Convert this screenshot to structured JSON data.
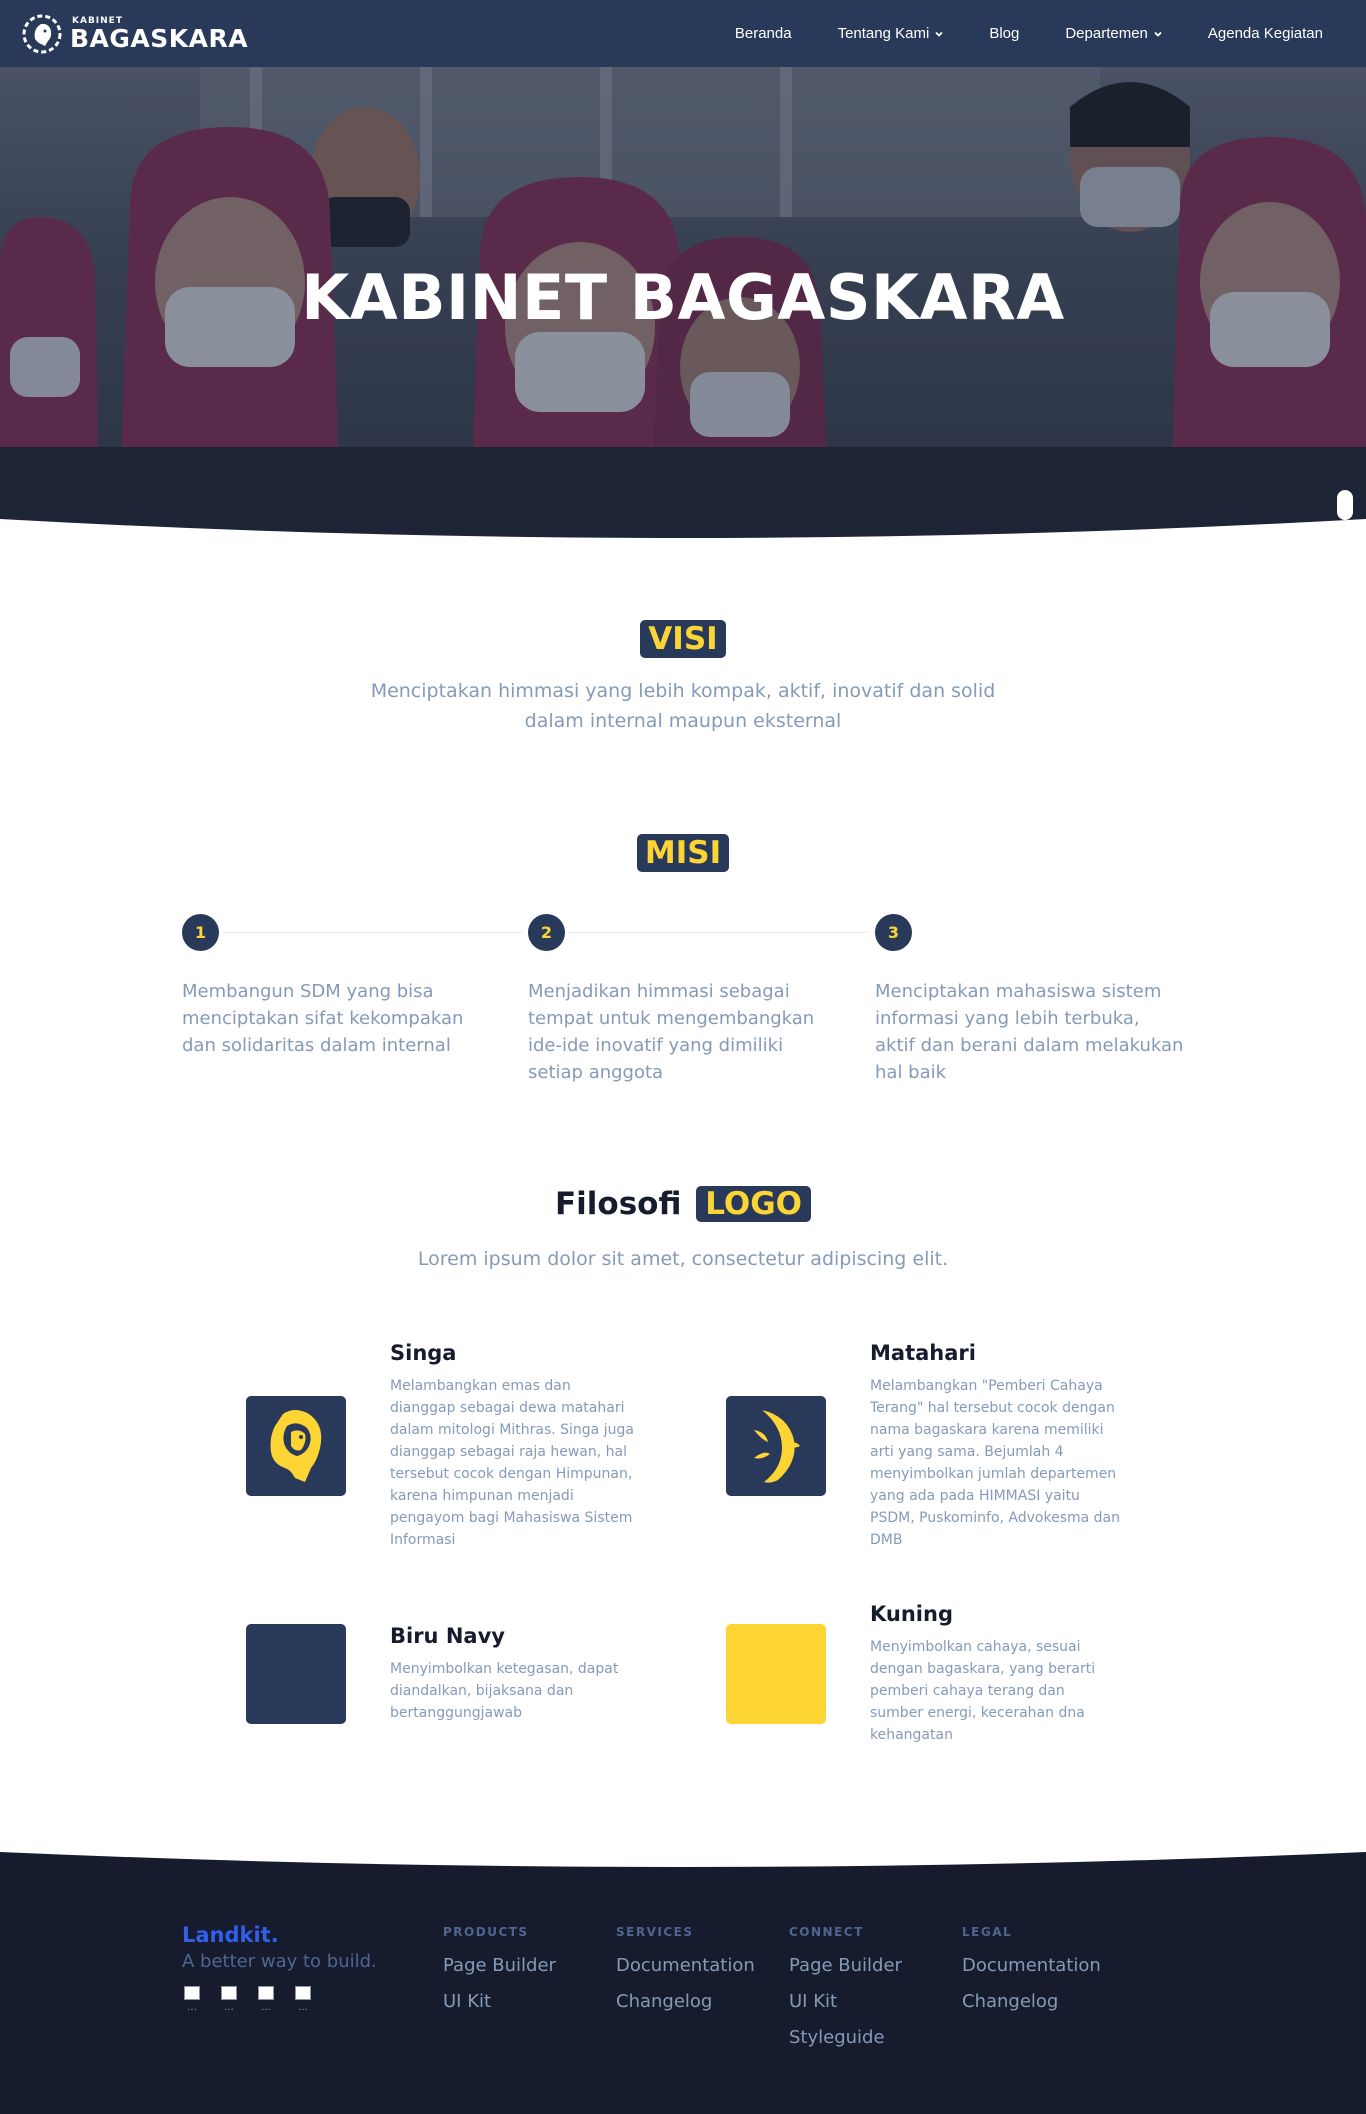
{
  "navbar": {
    "brand_small": "KABINET",
    "brand_big": "BAGASKARA",
    "items": [
      {
        "label": "Beranda",
        "dropdown": false
      },
      {
        "label": "Tentang Kami",
        "dropdown": true
      },
      {
        "label": "Blog",
        "dropdown": false
      },
      {
        "label": "Departemen",
        "dropdown": true
      },
      {
        "label": "Agenda Kegiatan",
        "dropdown": false
      }
    ]
  },
  "hero": {
    "title": "KABINET BAGASKARA"
  },
  "visi": {
    "badge": "VISI",
    "text_line1": "Menciptakan himmasi yang lebih kompak, aktif, inovatif dan solid",
    "text_line2": "dalam internal maupun eksternal"
  },
  "misi": {
    "badge": "MISI",
    "steps": [
      {
        "number": "1",
        "text": "Membangun SDM yang bisa menciptakan sifat kekompakan dan solidaritas dalam internal"
      },
      {
        "number": "2",
        "text": "Menjadikan himmasi sebagai tempat untuk mengembangkan ide-ide inovatif yang dimiliki setiap anggota"
      },
      {
        "number": "3",
        "text": "Menciptakan mahasiswa sistem informasi yang lebih terbuka, aktif dan berani dalam melakukan hal baik"
      }
    ]
  },
  "filosofi": {
    "title": "Filosofi",
    "badge": "LOGO",
    "subtitle": "Lorem ipsum dolor sit amet, consectetur adipiscing elit.",
    "items": [
      {
        "title": "Singa",
        "icon": "lion-icon",
        "text": "Melambangkan emas dan dianggap sebagai dewa matahari dalam mitologi Mithras. Singa juga dianggap sebagai raja hewan, hal tersebut cocok dengan Himpunan, karena himpunan menjadi pengayom bagi Mahasiswa Sistem Informasi"
      },
      {
        "title": "Matahari",
        "icon": "sun-icon",
        "text": "Melambangkan \"Pemberi Cahaya Terang\" hal tersebut cocok dengan nama bagaskara karena memiliki arti yang sama. Bejumlah 4 menyimbolkan jumlah departemen yang ada pada HIMMASI yaitu PSDM, Puskominfo, Advokesma dan DMB"
      },
      {
        "title": "Biru Navy",
        "color": "#283959",
        "text": "Menyimbolkan ketegasan, dapat diandalkan, bijaksana dan bertanggungjawab"
      },
      {
        "title": "Kuning",
        "color": "#fcd535",
        "text": "Menyimbolkan cahaya, sesuai dengan bagaskara, yang berarti pemberi cahaya terang dan sumber energi, kecerahan dna kehangatan"
      }
    ]
  },
  "colors": {
    "navy": "#283959",
    "yellow": "#fcd535",
    "footer": "#161c2d",
    "muted": "#869ab8",
    "brand_blue": "#335eea"
  },
  "footer": {
    "brand": "Landkit.",
    "tagline": "A better way to build.",
    "social_icons": [
      "image-icon",
      "image-icon",
      "image-icon",
      "image-icon"
    ],
    "columns": [
      {
        "heading": "PRODUCTS",
        "links": [
          "Page Builder",
          "UI Kit"
        ]
      },
      {
        "heading": "SERVICES",
        "links": [
          "Documentation",
          "Changelog"
        ]
      },
      {
        "heading": "CONNECT",
        "links": [
          "Page Builder",
          "UI Kit",
          "Styleguide"
        ]
      },
      {
        "heading": "LEGAL",
        "links": [
          "Documentation",
          "Changelog"
        ]
      }
    ]
  }
}
